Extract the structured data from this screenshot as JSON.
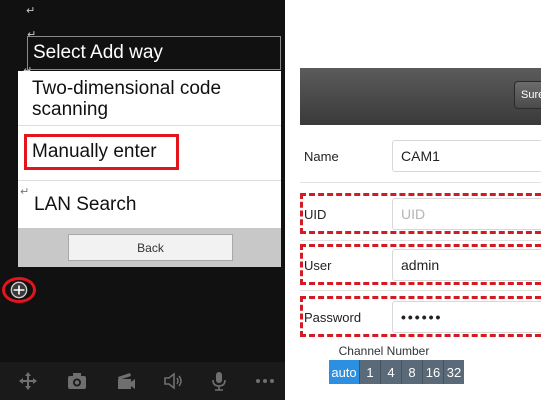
{
  "left_screen": {
    "dialog_title": "Select Add way",
    "options": [
      {
        "label": "Two-dimensional code scanning"
      },
      {
        "label": "Manually enter"
      },
      {
        "label": "LAN Search"
      }
    ],
    "back_label": "Back",
    "return_marks": [
      "↵",
      "↵",
      "↵",
      "↵"
    ],
    "add_icon": "add-device-icon",
    "toolbar_icons": [
      "ptz-move-icon",
      "camera-icon",
      "record-icon",
      "speaker-icon",
      "microphone-icon",
      "more-icon"
    ]
  },
  "right_screen": {
    "sure_label": "Sure",
    "fields": [
      {
        "label": "Name",
        "value": "CAM1",
        "placeholder": ""
      },
      {
        "label": "UID",
        "value": "",
        "placeholder": "UID"
      },
      {
        "label": "User",
        "value": "admin",
        "placeholder": ""
      },
      {
        "label": "Password",
        "value": "••••••",
        "placeholder": ""
      }
    ],
    "channel_label": "Channel Number",
    "channel_options": [
      "auto",
      "1",
      "4",
      "8",
      "16",
      "32"
    ],
    "channel_selected": "auto"
  },
  "colors": {
    "highlight_red": "#e3141c",
    "segment_active": "#2d8fe0",
    "segment_inactive": "#5a6a78"
  }
}
